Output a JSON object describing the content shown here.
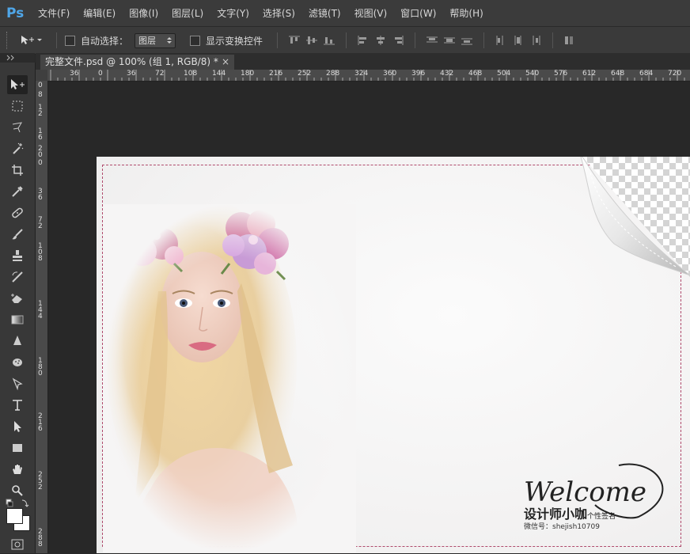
{
  "app": {
    "logo": "Ps"
  },
  "menu": [
    "文件(F)",
    "编辑(E)",
    "图像(I)",
    "图层(L)",
    "文字(Y)",
    "选择(S)",
    "滤镜(T)",
    "视图(V)",
    "窗口(W)",
    "帮助(H)"
  ],
  "options": {
    "auto_select_label": "自动选择：",
    "auto_select_value": "图层",
    "show_transform_label": "显示变换控件"
  },
  "document": {
    "tab_title": "完整文件.psd @ 100% (组 1, RGB/8) *",
    "close_glyph": "×"
  },
  "ruler_top": [
    "36",
    "0",
    "36",
    "72",
    "108",
    "144",
    "180",
    "216",
    "252",
    "288",
    "324",
    "360",
    "396",
    "432",
    "468",
    "504",
    "540",
    "576",
    "612",
    "648",
    "684",
    "720"
  ],
  "ruler_left": [
    "0",
    "8",
    "1 2",
    "1 6",
    "2 0",
    "0",
    "3 6",
    "7 2",
    "1 0 8",
    "1 4 4",
    "1 8 0",
    "2 1 6",
    "2 5 2",
    "2 8 8"
  ],
  "canvas": {
    "welcome_text": "Welcome",
    "signature_name": "设计师小咖",
    "signature_suffix": "个性签名",
    "wechat_line": "微信号：shejish10709"
  },
  "colors": {
    "accent_ps": "#4fa6e8",
    "guide_dash": "#b04a6c"
  },
  "tools": [
    "move-tool",
    "marquee-tool",
    "lasso-tool",
    "magic-wand-tool",
    "crop-tool",
    "eyedropper-tool",
    "healing-brush-tool",
    "brush-tool",
    "clone-stamp-tool",
    "history-brush-tool",
    "eraser-tool",
    "gradient-tool",
    "blur-tool",
    "dodge-tool",
    "pen-tool",
    "type-tool",
    "path-selection-tool",
    "rectangle-tool",
    "hand-tool",
    "zoom-tool"
  ]
}
